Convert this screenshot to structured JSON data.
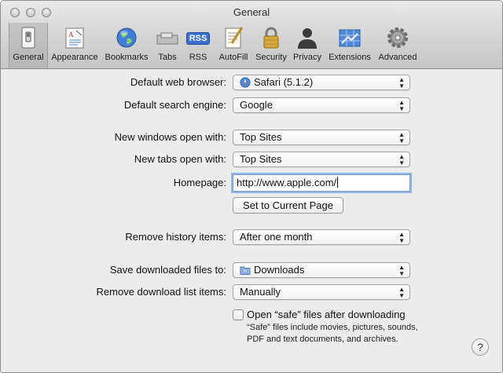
{
  "window": {
    "title": "General"
  },
  "toolbar": {
    "items": [
      {
        "label": "General",
        "icon": "general-switch-icon",
        "selected": true
      },
      {
        "label": "Appearance",
        "icon": "appearance-icon"
      },
      {
        "label": "Bookmarks",
        "icon": "globe-icon"
      },
      {
        "label": "Tabs",
        "icon": "tabs-icon"
      },
      {
        "label": "RSS",
        "icon": "rss-icon",
        "badge": "RSS"
      },
      {
        "label": "AutoFill",
        "icon": "autofill-icon"
      },
      {
        "label": "Security",
        "icon": "lock-icon"
      },
      {
        "label": "Privacy",
        "icon": "person-silhouette-icon"
      },
      {
        "label": "Extensions",
        "icon": "extensions-icon"
      },
      {
        "label": "Advanced",
        "icon": "gear-icon"
      }
    ]
  },
  "settings": {
    "default_browser": {
      "label": "Default web browser:",
      "value": "Safari (5.1.2)"
    },
    "search_engine": {
      "label": "Default search engine:",
      "value": "Google"
    },
    "new_windows": {
      "label": "New windows open with:",
      "value": "Top Sites"
    },
    "new_tabs": {
      "label": "New tabs open with:",
      "value": "Top Sites"
    },
    "homepage": {
      "label": "Homepage:",
      "value": "http://www.apple.com/"
    },
    "set_current_page": "Set to Current Page",
    "remove_history": {
      "label": "Remove history items:",
      "value": "After one month"
    },
    "save_downloads": {
      "label": "Save downloaded files to:",
      "value": "Downloads"
    },
    "remove_download_list": {
      "label": "Remove download list items:",
      "value": "Manually"
    },
    "open_safe_files": {
      "label": "Open “safe” files after downloading",
      "checked": false,
      "hint_line1": "“Safe” files include movies, pictures, sounds,",
      "hint_line2": "PDF and text documents, and archives."
    }
  },
  "help_button": "?",
  "colors": {
    "selected_toolbar_bg": "#bcbcbc",
    "focus_ring": "#8fb5ec",
    "rss_badge": "#3a6fd1",
    "extensions_blue": "#4f8ad8"
  }
}
